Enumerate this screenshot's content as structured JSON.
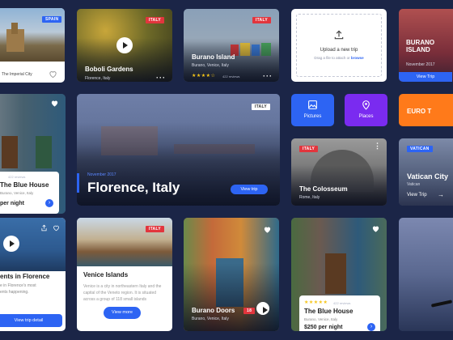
{
  "colors": {
    "background": "#1b2547",
    "accent": "#2d64f3",
    "tag_red": "#e2353d",
    "orange": "#ff7a1a",
    "purple": "#7a2bf0"
  },
  "c_spain": {
    "tag": "SPAIN",
    "subtitle": "The Imperial City"
  },
  "c_boboli": {
    "tag": "ITALY",
    "title": "Boboli Gardens",
    "subtitle": "Florence, Italy"
  },
  "c_burano1": {
    "tag": "ITALY",
    "title": "Burano Island",
    "subtitle": "Burano, Venice, Italy",
    "reviews": "422 reviews"
  },
  "upload": {
    "title": "Upload a new trip",
    "hint_prefix": "Drag a file to attach or",
    "hint_link": "browse"
  },
  "c_burano2": {
    "title_line1": "BURANO",
    "title_line2": "ISLAND",
    "subtitle": "November 2017",
    "button": "View Trip"
  },
  "c_bluehouse_left": {
    "reviews": "422 reviews",
    "title": "The Blue House",
    "subtitle": "Burano, Venice, Italy",
    "price": "per night"
  },
  "hero": {
    "tag": "ITALY",
    "date": "November 2017",
    "title": "Florence, Italy",
    "button": "View trip"
  },
  "pictures": {
    "label": "Pictures"
  },
  "places": {
    "label": "Places"
  },
  "euro": {
    "label": "EURO T"
  },
  "colosseum": {
    "tag": "ITALY",
    "title": "The Colosseum",
    "subtitle": "Rome, Italy"
  },
  "vatican": {
    "tag": "VATICAN",
    "title": "Vatican City",
    "subtitle": "Vatican",
    "button": "View Trip"
  },
  "events": {
    "title": "ents in Florence",
    "desc_line1": "e in Florence’s most",
    "desc_line2": "ents happening.",
    "button": "View trip detail"
  },
  "venice": {
    "tag": "ITALY",
    "title": "Venice Islands",
    "desc": "Venice is a city in northeastern Italy and the capital of the Veneto region. It is situated across a group of 118 small islands",
    "button": "View more"
  },
  "burano_doors": {
    "title": "Burano Doors",
    "subtitle": "Burano, Venice, Italy",
    "count": "18"
  },
  "bluehouse_mid": {
    "reviews": "422 reviews",
    "title": "The Blue House",
    "subtitle": "Burano, Venice, Italy",
    "price": "$250 per night"
  }
}
